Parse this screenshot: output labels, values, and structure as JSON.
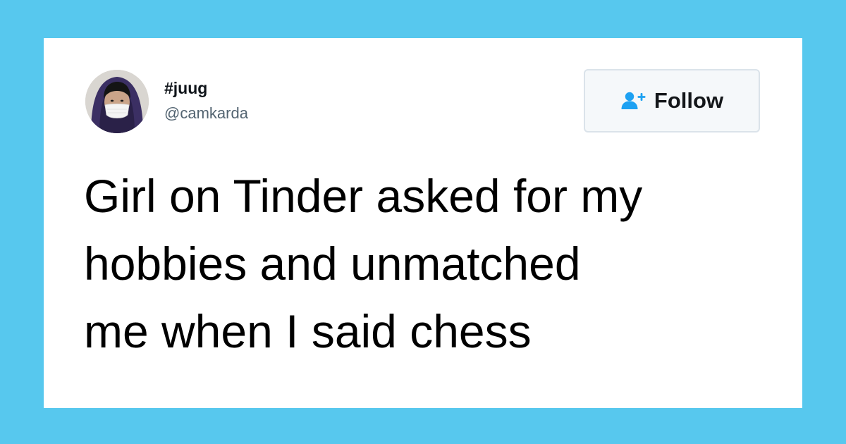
{
  "colors": {
    "background": "#57c8ee",
    "card": "#ffffff",
    "accent": "#1da1f2",
    "text_primary": "#0f1419",
    "text_secondary": "#536471"
  },
  "tweet": {
    "author": {
      "display_name": "#juug",
      "handle": "@camkarda",
      "avatar_icon": "user-avatar-photo"
    },
    "follow_button": {
      "label": "Follow",
      "icon": "add-user-icon"
    },
    "text": "Girl on Tinder asked for my\nhobbies and unmatched\nme when I said chess"
  }
}
